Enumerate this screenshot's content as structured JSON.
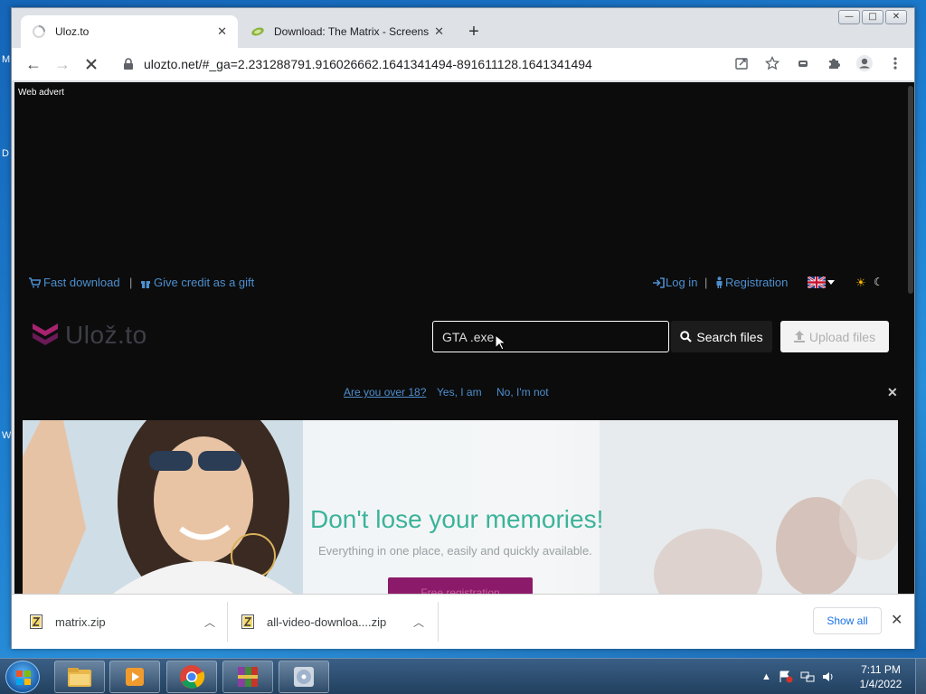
{
  "desktop": {
    "edge_letters": [
      "M",
      "D",
      "W"
    ]
  },
  "window": {
    "controls": [
      "—",
      "□",
      "✕"
    ]
  },
  "tabs": [
    {
      "title": "Uloz.to",
      "active": true,
      "close": "✕"
    },
    {
      "title": "Download: The Matrix - Screensa",
      "active": false,
      "close": "✕"
    }
  ],
  "new_tab": "+",
  "toolbar": {
    "url": "ulozto.net/#_ga=2.231288791.916026662.1641341494-891611128.1641341494",
    "back": "←",
    "forward": "→"
  },
  "page": {
    "ad_label": "Web advert",
    "nav": {
      "fast_download": "Fast download",
      "separator": "|",
      "give_credit": "Give credit as a gift",
      "login": "Log in",
      "registration": "Registration"
    },
    "logo_text": "Ulož.to",
    "search": {
      "value": "GTA .exe",
      "button": "Search files"
    },
    "upload_button": "Upload files",
    "age_check": {
      "question": "Are you over 18?",
      "yes": "Yes, I am",
      "no": "No, I'm not"
    },
    "hero": {
      "title": "Don't lose your memories!",
      "subtitle": "Everything in one place, easily and quickly available.",
      "cta": "Free registration"
    }
  },
  "downloads": {
    "items": [
      {
        "name": "matrix.zip"
      },
      {
        "name": "all-video-downloa....zip"
      }
    ],
    "show_all": "Show all",
    "close": "✕"
  },
  "taskbar": {
    "apps": [
      "explorer-icon",
      "media-player-icon",
      "chrome-icon",
      "winrar-icon",
      "disc-utility-icon"
    ],
    "time": "7:11 PM",
    "date": "1/4/2022"
  },
  "colors": {
    "link": "#4d8fcf",
    "hero_title": "#3bb39a",
    "cta": "#8c1a6a",
    "logo_mark": "#a8236f"
  }
}
